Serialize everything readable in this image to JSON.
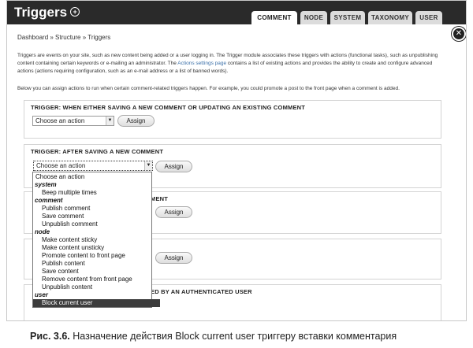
{
  "header": {
    "title": "Triggers",
    "tabs": [
      "COMMENT",
      "NODE",
      "SYSTEM",
      "TAXONOMY",
      "USER"
    ],
    "active_tab": "COMMENT"
  },
  "breadcrumb": "Dashboard » Structure » Triggers",
  "description": {
    "part1": "Triggers are events on your site, such as new content being added or a user logging in. The Trigger module associates these triggers with actions (functional tasks), such as unpublishing content containing certain keywords or e-mailing an administrator. The ",
    "link": "Actions settings page",
    "part2": " contains a list of existing actions and provides the ability to create and configure advanced actions (actions requiring configuration, such as an e-mail address or a list of banned words).",
    "line2": "Below you can assign actions to run when certain comment-related triggers happen. For example, you could promote a post to the front page when a comment is added."
  },
  "sections": [
    {
      "title": "TRIGGER: WHEN EITHER SAVING A NEW COMMENT OR UPDATING AN EXISTING COMMENT",
      "select_value": "Choose an action",
      "button": "Assign"
    },
    {
      "title": "TRIGGER: AFTER SAVING A NEW COMMENT",
      "select_value": "Choose an action",
      "button": "Assign"
    },
    {
      "title": "MENT",
      "button": "Assign"
    },
    {
      "title": "",
      "button": "Assign"
    },
    {
      "title": "ED BY AN AUTHENTICATED USER"
    }
  ],
  "dropdown": {
    "items": [
      {
        "label": "Choose an action",
        "kind": "top"
      },
      {
        "label": "system",
        "kind": "group"
      },
      {
        "label": "Beep multiple times",
        "kind": "opt"
      },
      {
        "label": "comment",
        "kind": "group"
      },
      {
        "label": "Publish comment",
        "kind": "opt"
      },
      {
        "label": "Save comment",
        "kind": "opt"
      },
      {
        "label": "Unpublish comment",
        "kind": "opt"
      },
      {
        "label": "node",
        "kind": "group"
      },
      {
        "label": "Make content sticky",
        "kind": "opt"
      },
      {
        "label": "Make content unsticky",
        "kind": "opt"
      },
      {
        "label": "Promote content to front page",
        "kind": "opt"
      },
      {
        "label": "Publish content",
        "kind": "opt"
      },
      {
        "label": "Save content",
        "kind": "opt"
      },
      {
        "label": "Remove content from front page",
        "kind": "opt"
      },
      {
        "label": "Unpublish content",
        "kind": "opt"
      },
      {
        "label": "user",
        "kind": "group"
      },
      {
        "label": "Block current user",
        "kind": "opt",
        "selected": true
      }
    ]
  },
  "caption": {
    "prefix": "Рис. 3.6.",
    "text": " Назначение действия Block current user триггеру вставки комментария"
  }
}
